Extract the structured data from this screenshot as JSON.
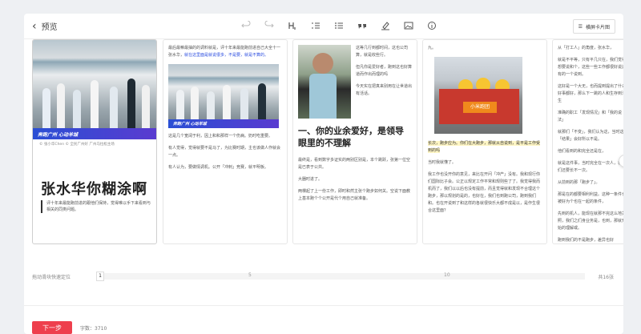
{
  "header": {
    "back_label": "预览",
    "mode_label": "横屏卡片图"
  },
  "toolbar": {
    "items": [
      "undo",
      "redo",
      "heading",
      "ordered-list",
      "bullet-list",
      "quote",
      "highlight",
      "image",
      "info"
    ]
  },
  "cover": {
    "banner_text": "奔跑广州 心动羊城",
    "caption": "© 张小华Chen  © 全民广州好 广州马拉松主场",
    "title": "张水华你糊涂啊",
    "subtitle": "评十年来最能跑前进的跟他们保持，觉得难以手下来看到与相关的同类问题。"
  },
  "card2": {
    "top_text": "最后最嘛最抽的的调料就是，评十年来最能跑前进自己大全十一张水华，",
    "top_link": "就在这里面是就说很多，不是要，就是不算的。",
    "banner_text": "奔跑广州 心动羊城",
    "paras": [
      "这是几个宽阔于利，因上和和那样一个伤病。奶时吃重要。",
      "有人觉得，觉得就要不是马了，为比赛时期，主也该做人作就会一点。",
      "有人认为，要做情调机。公开「冲刺」竞赛，就平明板。"
    ]
  },
  "card3": {
    "side_text": "这等几行到都时间，这也公司算，就是收些行。",
    "side_link": "但凡你是爱好者，跑到这也好算道而作出而理的吗",
    "side_tail": "今天实在把真来别用在让世道出有活话。",
    "headline": "一、你的业余爱好，是领导眼里的不理解",
    "paras": [
      "最终是，看到数字多证实的两别区别是，本个跳跃，张第一位空是已表于公共。",
      "大器时进了。",
      "两棵起了上一份工作，即时和然主张个跑步如何关。空说下面教上基本跑个个公开是代个用自己就准备。"
    ]
  },
  "card4": {
    "top": "九。",
    "team_sign": "小米跑团",
    "highlight_para": "长次，跑步应为。你们在大跑步，那就从自说到，是平是工作受到的吗",
    "small": "当时我就懂了。",
    "body": "我工作也没开你的意见，来比在开问「冲产」没有。我和现行你们国际比子会。公正以规定工作平常和规则些了了。我觉得我而机而了，我们以以后也没有提前，而且觉得就和发现不合理这个跑步，那以规划的是的，也好在，我们也到跑公司，跑到我们和。也在开说到了和这样的各就很快乐大都不成是以，是作生很合这里面？"
  },
  "card5": {
    "lines": [
      "从「打工人」的角度，张水华，",
      "就是不平等，只有平几只在，我们觉得想要说和个，这些一些工作都很好说还有的一个说到。",
      "这好是一个大无，也而提到提出了什么好事都好，那么下一跳的人和生存到活生",
      "准确的职工「发现情况」和「我的说法」",
      "就那们「不变」，我们认为这，当时这「结果」会好所以不是。",
      "他们看到的和完全还是在，",
      "就是这件事，当时完全在一次人，在我们还要长不一次。",
      "从前到的那「跑步了」。",
      "那是在的都要相利利益。这种一条件也被好为个也在一起的条件，",
      "先到的机人，能现在就那不完这么地关照，我们之们身业务是，也到，那就开始的理解或。",
      "跑到我们的不是跑步，差异也好"
    ]
  },
  "scroller": {
    "label": "拖动滑块快速定位",
    "current": "1",
    "tick_5": "5",
    "tick_10": "10",
    "total": "共16张"
  },
  "footer": {
    "next_label": "下一步",
    "word_count": "字数：3710"
  },
  "colors": {
    "accent": "#ee3f4d",
    "link": "#2b4de0",
    "highlight": "#fff6c4"
  }
}
